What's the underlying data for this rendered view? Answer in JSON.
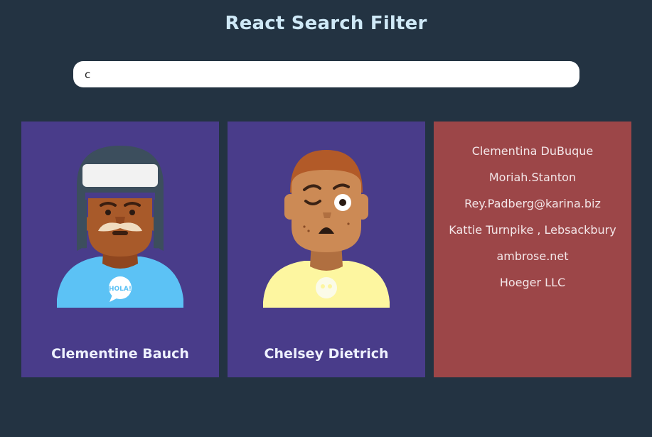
{
  "app": {
    "title": "React Search Filter"
  },
  "search": {
    "value": "c",
    "placeholder": ""
  },
  "cards": [
    {
      "name": "Clementine Bauch",
      "avatar": "mustache-man-in-hat-avatar",
      "shirt_badge": "HOLA!"
    },
    {
      "name": "Chelsey Dietrich",
      "avatar": "winking-boy-avatar"
    }
  ],
  "detail_card": {
    "name": "Clementina DuBuque",
    "username": "Moriah.Stanton",
    "email": "Rey.Padberg@karina.biz",
    "address": "Kattie Turnpike , Lebsackbury",
    "website": "ambrose.net",
    "company": "Hoeger LLC"
  },
  "colors": {
    "background": "#233342",
    "card": "#493c8a",
    "detail_card": "#9c4648",
    "title": "#cfe9f7"
  }
}
